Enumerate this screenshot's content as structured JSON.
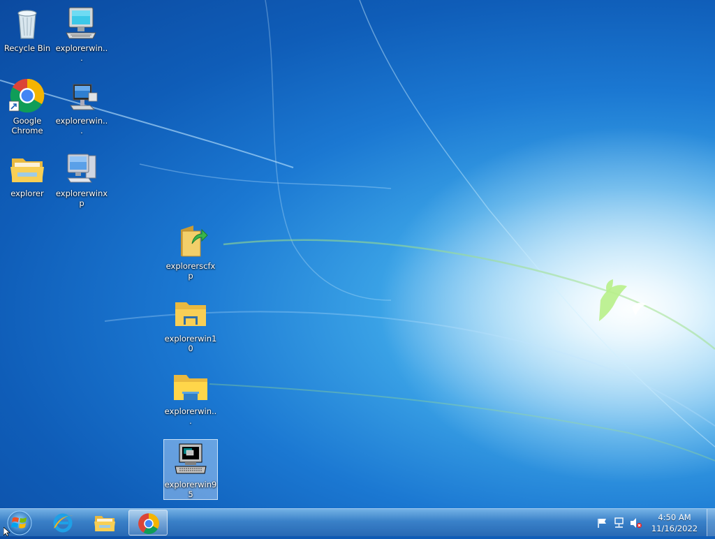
{
  "desktop": {
    "icons": [
      {
        "label": "Recycle Bin",
        "icon": "recycle-bin-icon"
      },
      {
        "label": "explorerwin...",
        "icon": "computer-monitor-icon"
      },
      {
        "label": "Google Chrome",
        "icon": "chrome-icon"
      },
      {
        "label": "explorerwin...",
        "icon": "network-computer-icon"
      },
      {
        "label": "explorer",
        "icon": "folder-icon"
      },
      {
        "label": "explorerwinxp",
        "icon": "desktop-computer-icon"
      },
      {
        "label": "explorerscfxp",
        "icon": "folder-sync-icon"
      },
      {
        "label": "explorerwin10",
        "icon": "folder-icon"
      },
      {
        "label": "explorerwin...",
        "icon": "folder-icon"
      },
      {
        "label": "explorerwin95",
        "icon": "retro-computer-icon"
      }
    ]
  },
  "taskbar": {
    "pinned": [
      {
        "name": "Internet Explorer",
        "icon": "internet-explorer-icon"
      },
      {
        "name": "File Explorer",
        "icon": "folder-icon"
      },
      {
        "name": "Google Chrome",
        "icon": "chrome-icon",
        "active": true
      }
    ],
    "tray": {
      "icons": [
        "action-center-flag-icon",
        "network-icon",
        "volume-muted-icon"
      ],
      "time": "4:50 AM",
      "date": "11/16/2022"
    }
  },
  "colors": {
    "taskbar": "#3c82c8",
    "desktop_blue": "#1b78d2",
    "chrome_red": "#db4437",
    "chrome_green": "#0f9d58",
    "chrome_yellow": "#f4b400",
    "chrome_blue": "#4285f4",
    "folder_yellow": "#f8cf55"
  }
}
